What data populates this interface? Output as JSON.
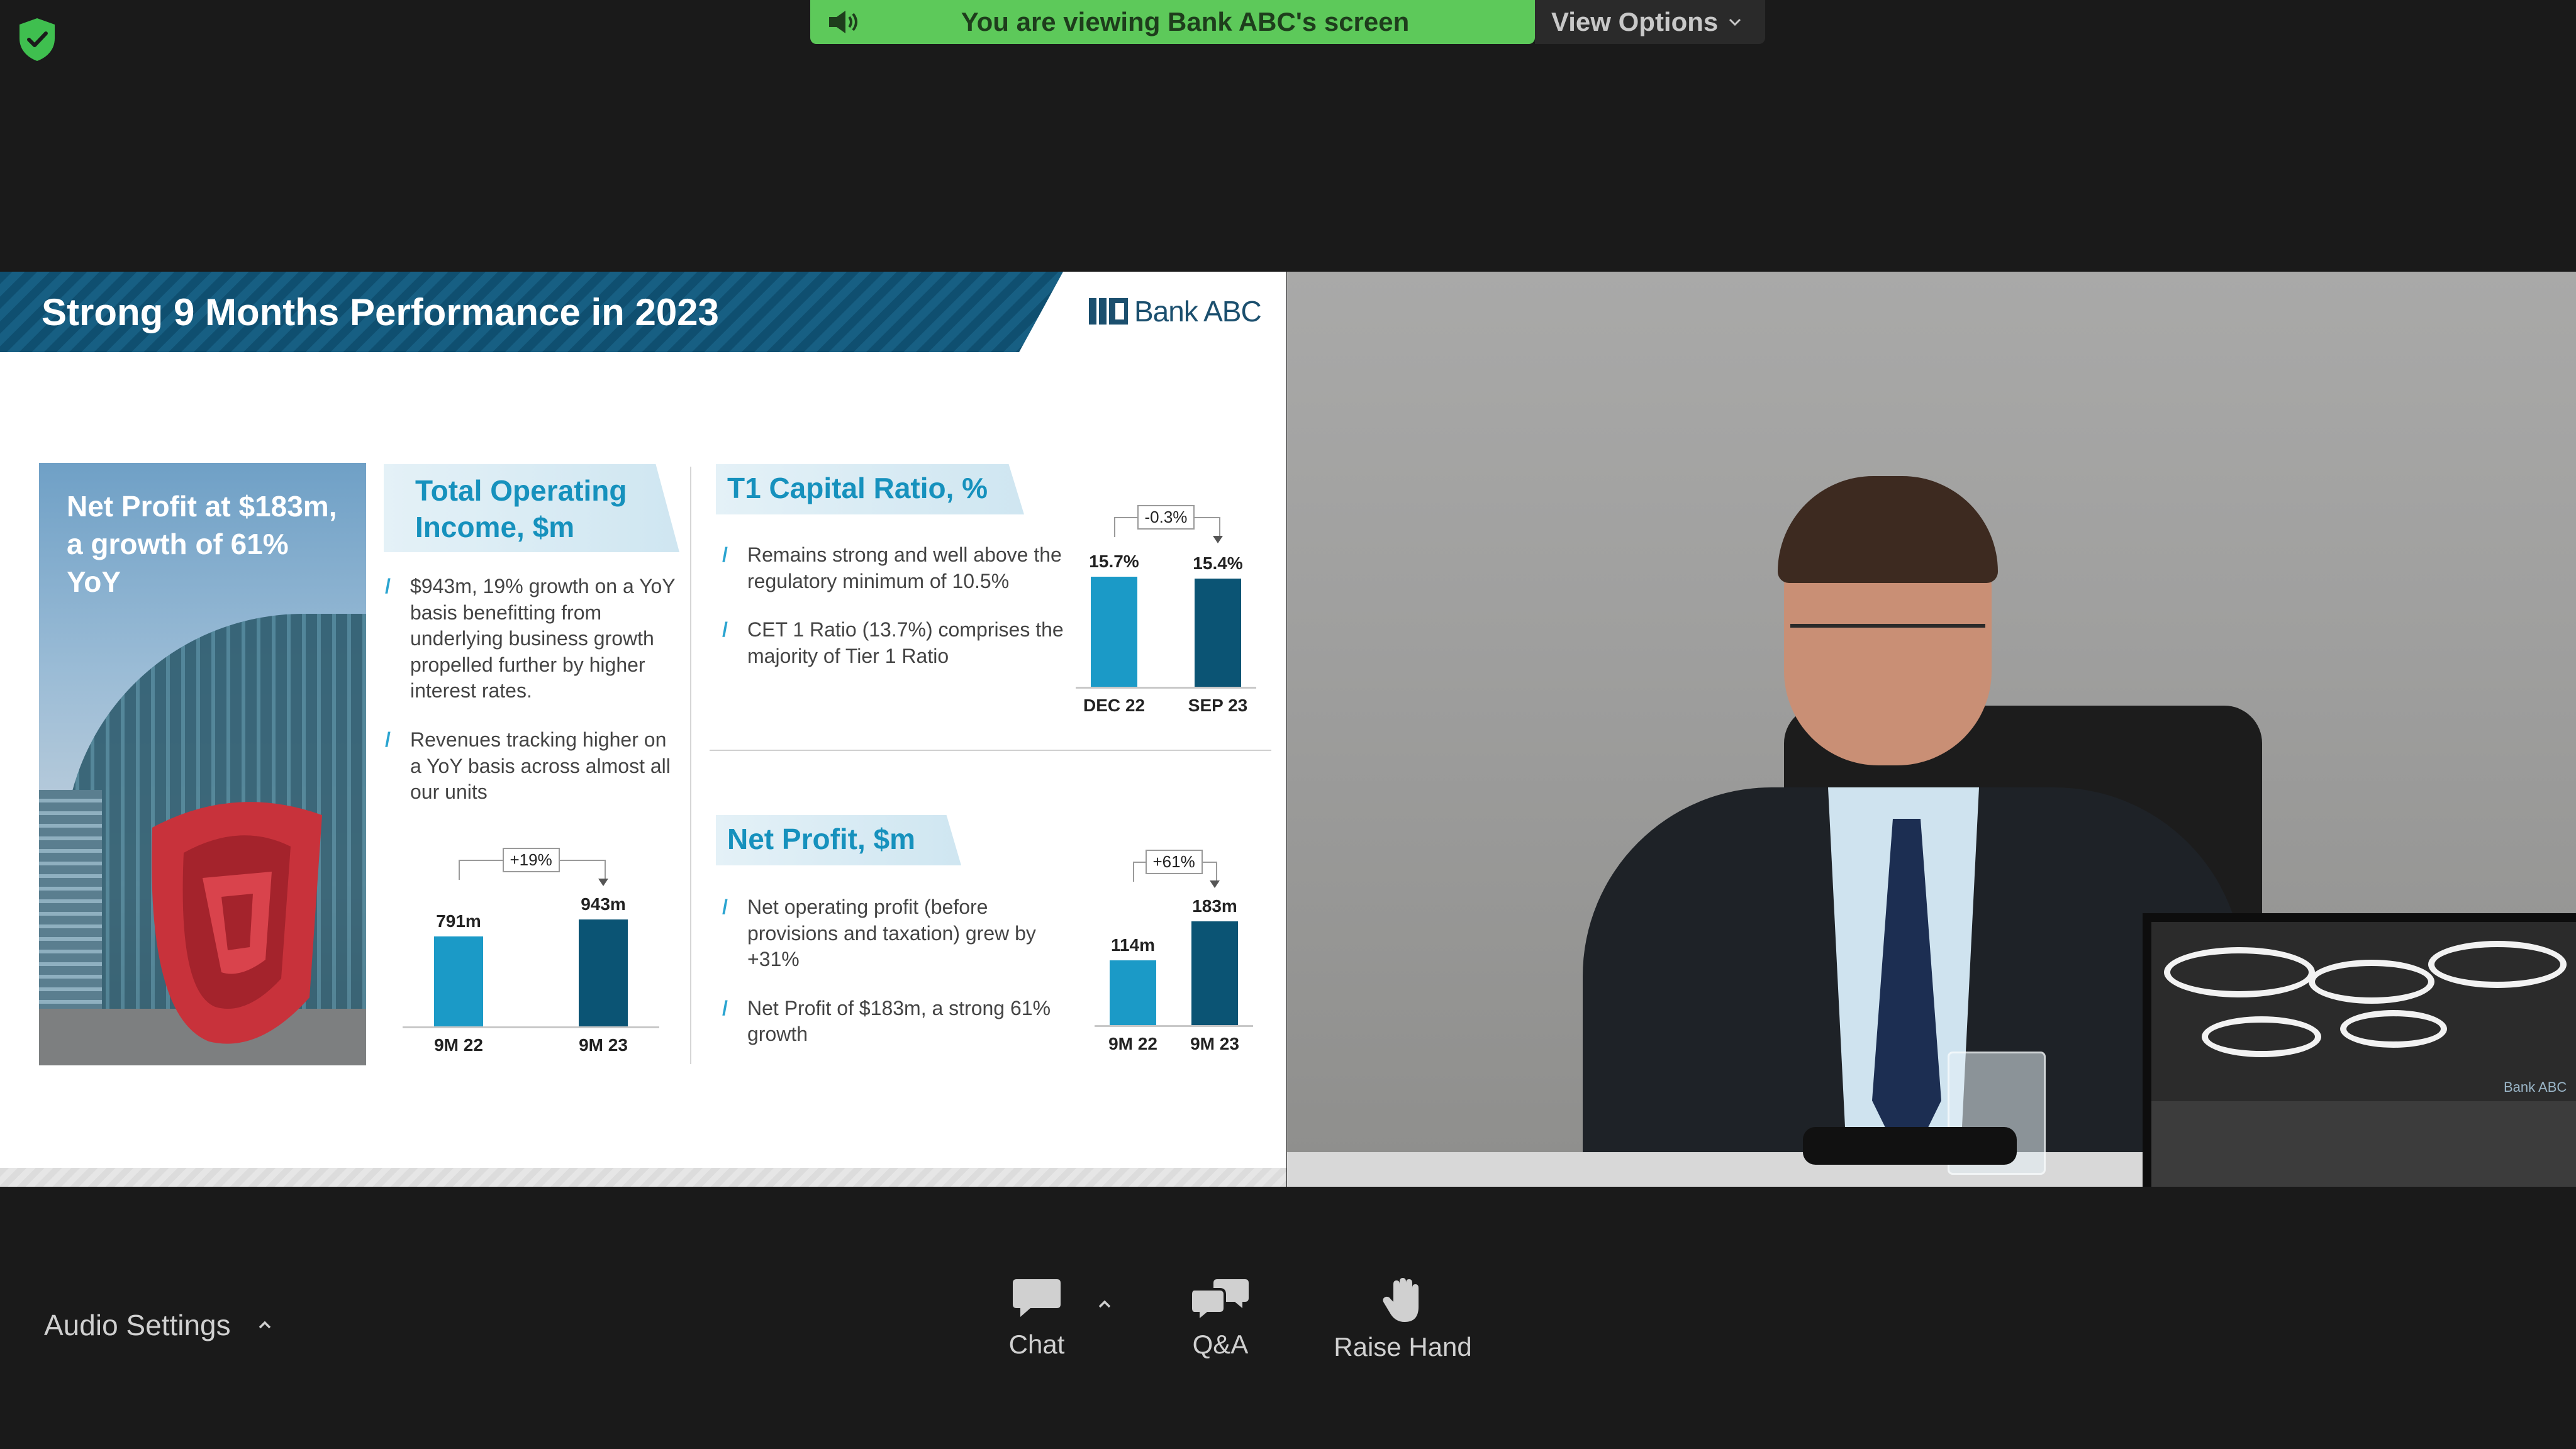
{
  "top_bar": {
    "banner_text": "You are viewing Bank ABC's screen",
    "view_options_label": "View Options"
  },
  "slide": {
    "title": "Strong 9 Months Performance in 2023",
    "brand": "Bank ABC",
    "hero_text": "Net Profit at $183m, a growth of 61% YoY",
    "sections": {
      "income": {
        "heading": "Total Operating Income, $m",
        "bullets": [
          "$943m, 19% growth on a YoY basis benefitting from underlying business growth propelled further by higher interest rates.",
          "Revenues tracking higher on a YoY basis across almost all our units"
        ]
      },
      "t1": {
        "heading": "T1 Capital Ratio, %",
        "bullets": [
          "Remains strong and well above the regulatory minimum of 10.5%",
          "CET 1 Ratio (13.7%) comprises the majority of Tier 1 Ratio"
        ]
      },
      "net_profit": {
        "heading": "Net Profit, $m",
        "bullets": [
          "Net operating profit (before provisions and taxation) grew by +31%",
          "Net Profit of $183m, a strong 61% growth"
        ]
      }
    }
  },
  "chart_data": [
    {
      "type": "bar",
      "title": "Total Operating Income, $m",
      "categories": [
        "9M 22",
        "9M 23"
      ],
      "values": [
        791,
        943
      ],
      "value_labels": [
        "791m",
        "943m"
      ],
      "delta_label": "+19%",
      "ylim": [
        0,
        943
      ],
      "colors": [
        "#1b9ac7",
        "#0b5474"
      ]
    },
    {
      "type": "bar",
      "title": "T1 Capital Ratio, %",
      "categories": [
        "DEC 22",
        "SEP 23"
      ],
      "values": [
        15.7,
        15.4
      ],
      "value_labels": [
        "15.7%",
        "15.4%"
      ],
      "delta_label": "-0.3%",
      "ylim": [
        0,
        15.7
      ],
      "colors": [
        "#1b9ac7",
        "#0b5474"
      ]
    },
    {
      "type": "bar",
      "title": "Net Profit, $m",
      "categories": [
        "9M 22",
        "9M 23"
      ],
      "values": [
        114,
        183
      ],
      "value_labels": [
        "114m",
        "183m"
      ],
      "delta_label": "+61%",
      "ylim": [
        0,
        183
      ],
      "colors": [
        "#1b9ac7",
        "#0b5474"
      ]
    }
  ],
  "video": {
    "monitor_logo": "Bank ABC"
  },
  "bottom_bar": {
    "audio_settings_label": "Audio Settings",
    "chat_label": "Chat",
    "qa_label": "Q&A",
    "raise_hand_label": "Raise Hand"
  },
  "colors": {
    "banner_green": "#5dc95a",
    "brand_blue": "#1691bd",
    "brand_dark": "#0b5474",
    "background": "#1a1a1a"
  },
  "icons": [
    "shield-check-icon",
    "speaker-icon",
    "chevron-down-icon",
    "chat-icon",
    "qa-icon",
    "raise-hand-icon",
    "caret-up-icon"
  ]
}
